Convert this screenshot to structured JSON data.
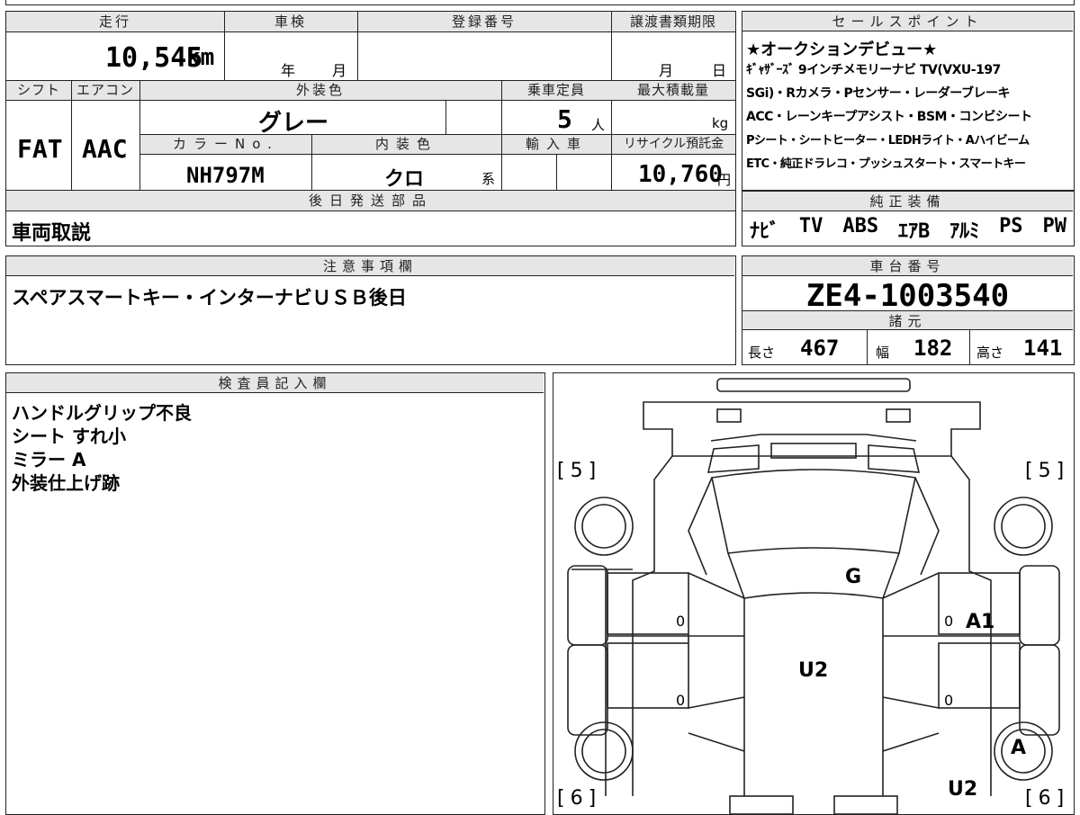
{
  "top_strip": {
    "partial": ""
  },
  "main": {
    "mileage_label": "走行",
    "mileage_value": "10,545",
    "mileage_unit": "km",
    "inspection_label": "車検",
    "inspection_year": "年",
    "inspection_month": "月",
    "registration_label": "登録番号",
    "registration_value": "",
    "transfer_label": "譲渡書類期限",
    "transfer_month": "月",
    "transfer_day": "日",
    "shift_label": "シフト",
    "shift_value": "FAT",
    "ac_label": "エアコン",
    "ac_value": "AAC",
    "exterior_color_label": "外装色",
    "exterior_color_value": "グレー",
    "capacity_label": "乗車定員",
    "capacity_value": "5",
    "capacity_unit": "人",
    "max_load_label": "最大積載量",
    "max_load_unit": "kg",
    "color_no_label": "カラーNo.",
    "color_no_value": "NH797M",
    "interior_color_label": "内装色",
    "interior_color_value": "クロ",
    "interior_color_suffix": "系",
    "import_label": "輸入車",
    "recycle_label": "リサイクル預託金",
    "recycle_value": "10,760",
    "recycle_unit": "円",
    "later_parts_label": "後日発送部品",
    "later_parts_value": "車両取説"
  },
  "sales_points": {
    "label": "セールスポイント",
    "lines": [
      "★オークションデビュー★",
      "ｷﾞｬｻﾞｰｽﾞ 9インチメモリーナビ TV(VXU-197",
      "SGi)・Rカメラ・Pセンサー・レーダーブレーキ",
      "ACC・レーンキープアシスト・BSM・コンビシート",
      "Pシート・シートヒーター・LEDHライト・Aハイビーム",
      "ETC・純正ドラレコ・プッシュスタート・スマートキー"
    ]
  },
  "standard_equipment": {
    "label": "純正装備",
    "items": [
      "ﾅﾋﾞ",
      "TV",
      "ABS",
      "ｴｱB",
      "ｱﾙﾐ",
      "PS",
      "PW"
    ]
  },
  "notes": {
    "label": "注意事項欄",
    "value": "スペアスマートキー・インターナビＵＳＢ後日"
  },
  "chassis": {
    "label": "車台番号",
    "value": "ZE4-1003540"
  },
  "specs": {
    "label": "諸元",
    "length_label": "長さ",
    "length_value": "467",
    "width_label": "幅",
    "width_value": "182",
    "height_label": "高さ",
    "height_value": "141"
  },
  "inspector": {
    "label": "検査員記入欄",
    "lines": [
      "ハンドルグリップ不良",
      "シート すれ小",
      "ミラー A",
      "外装仕上げ跡"
    ]
  },
  "diagram": {
    "tire_front_left": "5",
    "tire_front_right": "5",
    "tire_rear_left": "6",
    "tire_rear_right": "6",
    "mark_windshield": "G",
    "mark_roof": "U2",
    "mark_right_front_door": "A1",
    "mark_right_rear_wheel": "A",
    "mark_rear_right": "U2",
    "mark_left_front_door_zero": "0",
    "mark_left_rear_door_zero": "0",
    "mark_right_front_door_zero": "0",
    "mark_right_rear_door_zero": "0"
  }
}
